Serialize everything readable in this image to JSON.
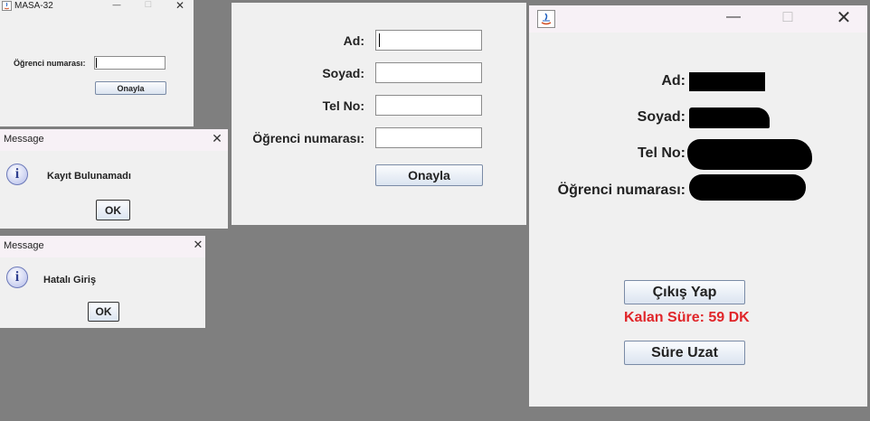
{
  "login_window": {
    "title": "MASA-32",
    "student_no_label": "Öğrenci numarası:",
    "student_no_value": "",
    "confirm_label": "Onayla",
    "controls": {
      "minimize": "—",
      "maximize": "□",
      "close": "✕"
    }
  },
  "message_not_found": {
    "title": "Message",
    "text": "Kayıt Bulunamadı",
    "ok_label": "OK",
    "close": "✕",
    "icon": "info-icon"
  },
  "message_invalid": {
    "title": "Message",
    "text": "Hatalı Giriş",
    "ok_label": "OK",
    "close": "✕",
    "icon": "info-icon"
  },
  "register_window": {
    "fields": [
      {
        "label": "Ad:",
        "value": ""
      },
      {
        "label": "Soyad:",
        "value": ""
      },
      {
        "label": "Tel No:",
        "value": ""
      },
      {
        "label": "Öğrenci numarası:",
        "value": ""
      }
    ],
    "confirm_label": "Onayla"
  },
  "session_window": {
    "controls": {
      "minimize": "—",
      "maximize": "□",
      "close": "✕"
    },
    "labels": {
      "name": "Ad:",
      "surname": "Soyad:",
      "phone": "Tel No:",
      "student_no": "Öğrenci numarası:"
    },
    "logout_label": "Çıkış Yap",
    "remaining_time": "Kalan Süre: 59 DK",
    "extend_label": "Süre Uzat",
    "colors": {
      "remaining_time": "#e0262a"
    }
  }
}
